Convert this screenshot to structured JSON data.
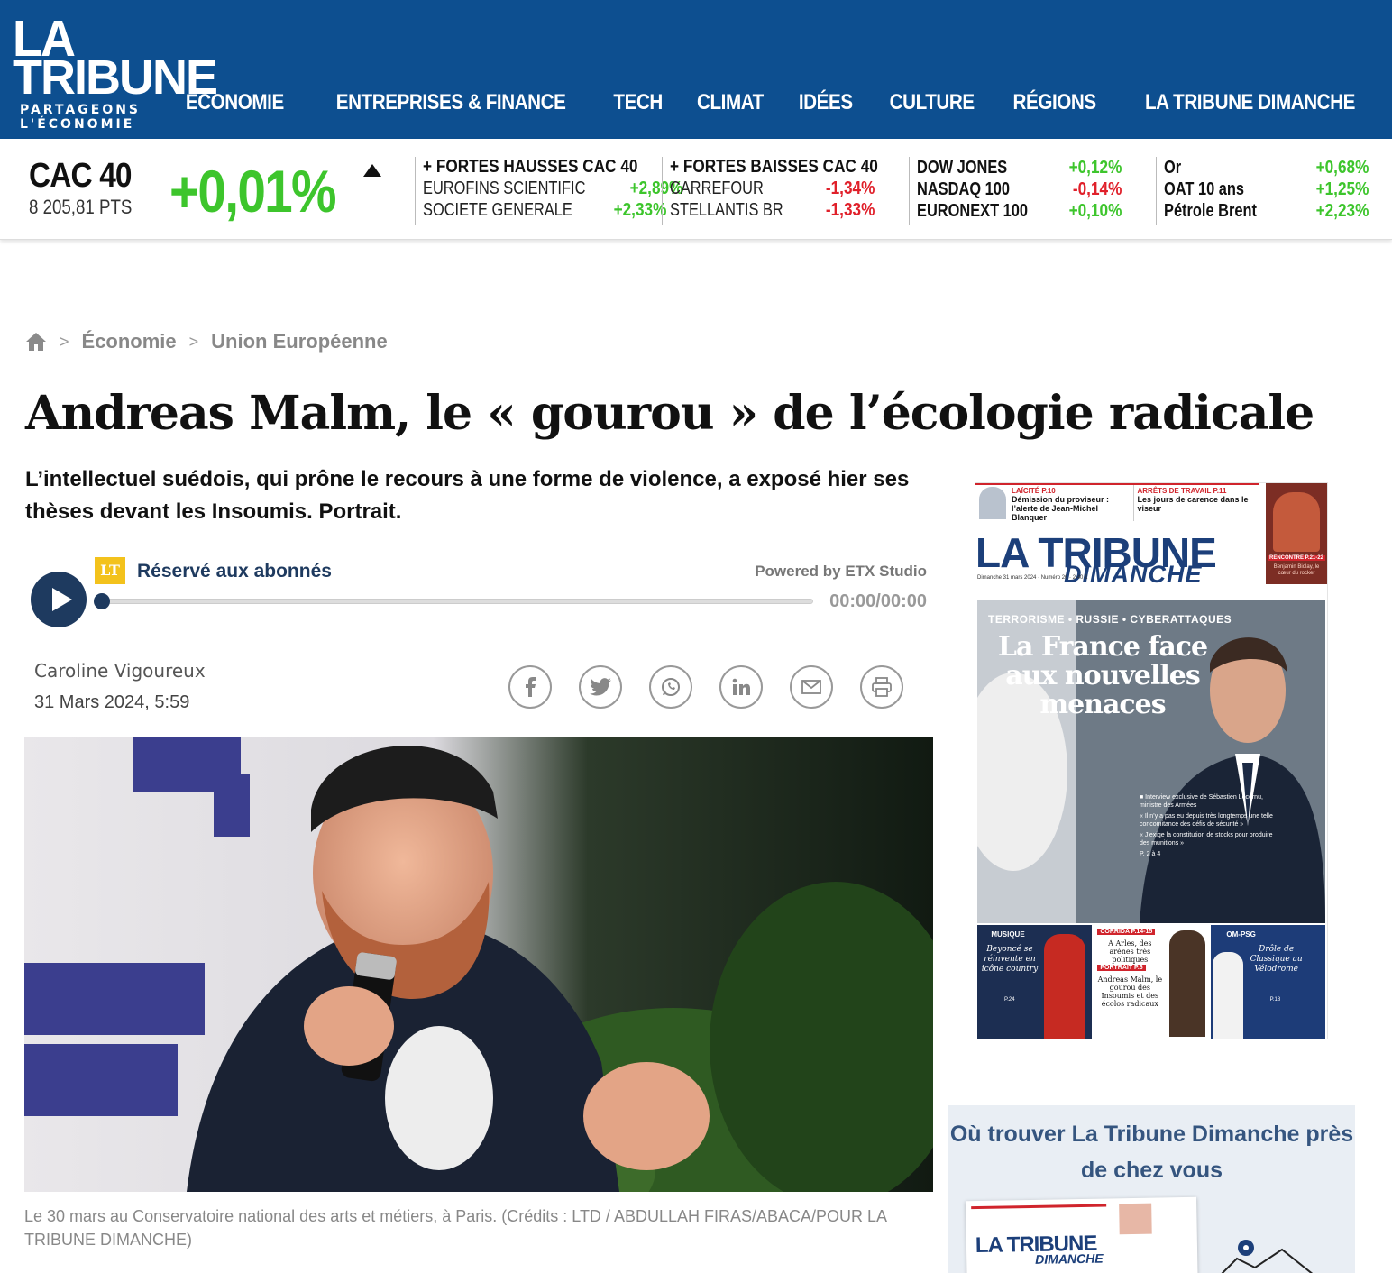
{
  "header": {
    "logo_line1": "LA",
    "logo_line2": "TRIBUNE",
    "logo_tagline": "PARTAGEONS L'ÉCONOMIE",
    "nav": [
      "ÉCONOMIE",
      "ENTREPRISES & FINANCE",
      "TECH",
      "CLIMAT",
      "IDÉES",
      "CULTURE",
      "RÉGIONS",
      "LA TRIBUNE DIMANCHE"
    ],
    "bg_color": "#0d4f90"
  },
  "ticker": {
    "cac_name": "CAC 40",
    "cac_points": "8 205,81 PTS",
    "cac_change": "+0,01%",
    "cac_direction": "up",
    "hausses": {
      "heading": "+ FORTES HAUSSES CAC 40",
      "rows": [
        {
          "name": "EUROFINS SCIENTIFIC",
          "value": "+2,89%"
        },
        {
          "name": "SOCIETE GENERALE",
          "value": "+2,33%"
        }
      ]
    },
    "baisses": {
      "heading": "+ FORTES BAISSES CAC 40",
      "rows": [
        {
          "name": "CARREFOUR",
          "value": "-1,34%"
        },
        {
          "name": "STELLANTIS BR",
          "value": "-1,33%"
        }
      ]
    },
    "indices": [
      {
        "name": "DOW JONES",
        "value": "+0,12%"
      },
      {
        "name": "NASDAQ 100",
        "value": "-0,14%"
      },
      {
        "name": "EURONEXT 100",
        "value": "+0,10%"
      }
    ],
    "commodities": [
      {
        "name": "Or",
        "value": "+0,68%"
      },
      {
        "name": "OAT 10 ans",
        "value": "+1,25%"
      },
      {
        "name": "Pétrole Brent",
        "value": "+2,23%"
      }
    ],
    "up_color": "#3dc52c",
    "down_color": "#e0202a"
  },
  "breadcrumb": {
    "home_icon": "home-icon",
    "items": [
      "Économie",
      "Union Européenne"
    ],
    "separator": ">"
  },
  "article": {
    "title": "Andreas Malm, le « gourou » de l’écologie radicale",
    "lead": "L’intellectuel suédois, qui prône le recours à une forme de violence, a exposé hier ses thèses devant les Insoumis. Portrait.",
    "author": "Caroline Vigoureux",
    "date": "31 Mars 2024, 5:59",
    "caption": "Le 30 mars au Conservatoire national des arts et métiers, à Paris. (Crédits : LTD / ABDULLAH FIRAS/ABACA/POUR LA TRIBUNE DIMANCHE)"
  },
  "player": {
    "badge": "LT",
    "reserved_label": "Réservé aux abonnés",
    "powered_by": "Powered by  ETX Studio",
    "time": "00:00/00:00",
    "progress": 0
  },
  "share": {
    "icons": [
      "facebook-icon",
      "twitter-icon",
      "whatsapp-icon",
      "linkedin-icon",
      "email-icon",
      "print-icon"
    ]
  },
  "sidebar_cover": {
    "top1_kicker": "LAÏCITÉ P.10",
    "top1_text": "Démission du proviseur : l’alerte de Jean-Michel Blanquer",
    "top2_kicker": "ARRÊTS DE TRAVAIL P.11",
    "top2_text": "Les jours de carence dans le viseur",
    "logo": "LA TRIBUNE",
    "logo_sub": "DIMANCHE",
    "dateline": "Dimanche 31 mars 2024 · Numéro 26 · 2,40 €",
    "rencontre": "RENCONTRE P.21-22",
    "rencontre_text": "Benjamin Biolay, le cœur du rocker",
    "kicker": "TERRORISME • RUSSIE • CYBERATTAQUES",
    "headline": "La France face aux nouvelles menaces",
    "bullets": [
      "■ Interview exclusive de Sébastien Lecornu, ministre des Armées",
      "« Il n’y a pas eu depuis très longtemps une telle concomitance des défis de sécurité »",
      "« J’exige la constitution de stocks pour produire des munitions »",
      "P. 2 à 4"
    ],
    "bottom": [
      {
        "kicker": "MUSIQUE",
        "text": "Beyoncé se réinvente en icône country",
        "page": "P.24"
      },
      {
        "kicker": "CORRIDA P.14-15",
        "text": "À Arles, des arènes très politiques",
        "kicker2": "PORTRAIT P.6",
        "text2": "Andreas Malm, le gourou des Insoumis et des écolos radicaux"
      },
      {
        "kicker": "OM-PSG",
        "text": "Drôle de Classique au Vélodrome",
        "page": "P.18"
      }
    ]
  },
  "ad": {
    "title": "Où trouver La Tribune Dimanche près de chez vous",
    "paper_logo": "LA TRIBUNE",
    "paper_sub": "DIMANCHE"
  }
}
